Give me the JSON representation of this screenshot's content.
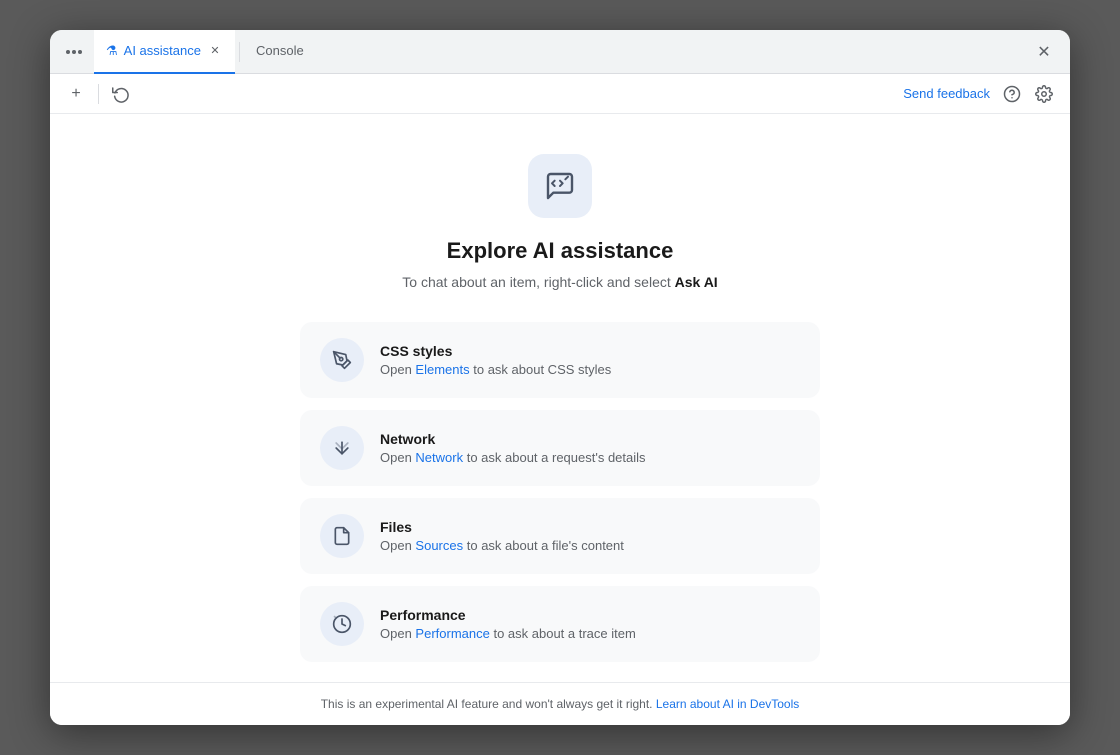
{
  "titlebar": {
    "tab_ai_label": "AI assistance",
    "tab_ai_icon": "⚗",
    "tab_console_label": "Console",
    "close_label": "✕"
  },
  "toolbar": {
    "new_tab_label": "+",
    "history_label": "↺",
    "send_feedback_label": "Send feedback",
    "help_label": "?",
    "settings_label": "⚙"
  },
  "main": {
    "icon_alt": "AI chat icon",
    "title": "Explore AI assistance",
    "subtitle_prefix": "To chat about an item, right-click and select ",
    "subtitle_bold": "Ask AI",
    "features": [
      {
        "name": "CSS styles",
        "desc_prefix": "Open ",
        "link_label": "Elements",
        "desc_suffix": " to ask about CSS styles",
        "icon": "✏"
      },
      {
        "name": "Network",
        "desc_prefix": "Open ",
        "link_label": "Network",
        "desc_suffix": " to ask about a request's details",
        "icon": "↕"
      },
      {
        "name": "Files",
        "desc_prefix": "Open ",
        "link_label": "Sources",
        "desc_suffix": " to ask about a file's content",
        "icon": "📄"
      },
      {
        "name": "Performance",
        "desc_prefix": "Open ",
        "link_label": "Performance",
        "desc_suffix": " to ask about a trace item",
        "icon": "⏱"
      }
    ]
  },
  "footer": {
    "text_prefix": "This is an experimental AI feature and won't always get it right. ",
    "link_label": "Learn about AI in DevTools"
  }
}
